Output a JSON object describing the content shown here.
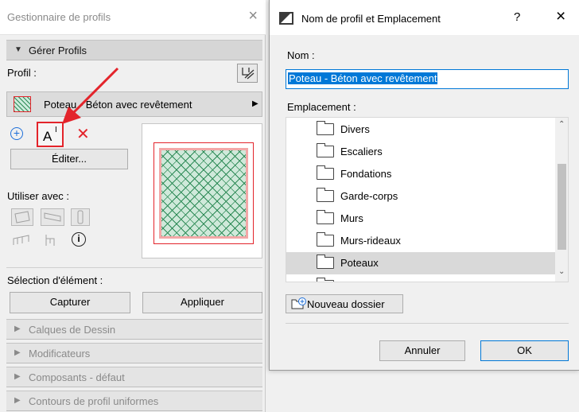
{
  "left_panel": {
    "title": "Gestionnaire de profils",
    "close_glyph": "×",
    "manage_section": "Gérer Profils",
    "profile_label": "Profil :",
    "profile_name": "Poteau - Béton avec revêtement",
    "edit_button": "Éditer...",
    "use_with_label": "Utiliser avec :",
    "element_selection_label": "Sélection d'élément :",
    "capture_button": "Capturer",
    "apply_button": "Appliquer",
    "collapsed_sections": [
      "Calques de Dessin",
      "Modificateurs",
      "Composants - défaut",
      "Contours de profil uniformes"
    ],
    "rename_icon_text": "A",
    "delete_glyph": "✕"
  },
  "dialog": {
    "title": "Nom de profil et Emplacement",
    "help_glyph": "?",
    "close_glyph": "×",
    "name_label": "Nom :",
    "name_value": "Poteau - Béton avec revêtement",
    "location_label": "Emplacement :",
    "folders": [
      "Divers",
      "Escaliers",
      "Fondations",
      "Garde-corps",
      "Murs",
      "Murs-rideaux",
      "Poteaux"
    ],
    "selected_folder": "Poteaux",
    "new_folder_button": "Nouveau dossier",
    "cancel_button": "Annuler",
    "ok_button": "OK"
  },
  "colors": {
    "highlight": "#e3242b",
    "selection_blue": "#0078d7",
    "hatch_green": "#2e8b57"
  }
}
